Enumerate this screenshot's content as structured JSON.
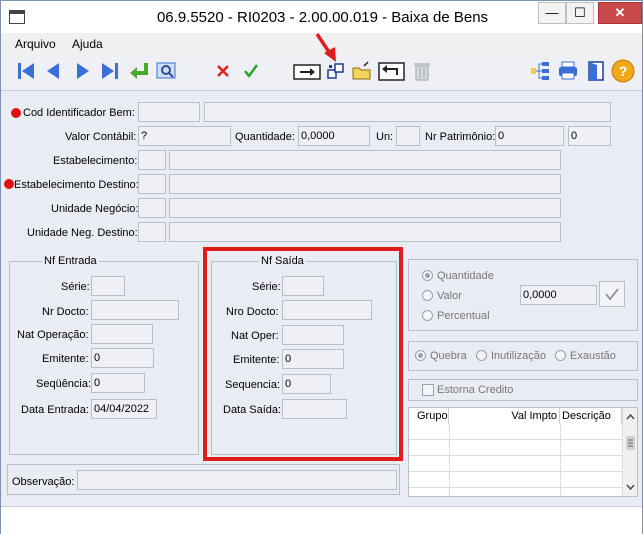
{
  "window": {
    "title": "06.9.5520 - RI0203 - 2.00.00.019 - Baixa de Bens",
    "min": "—",
    "max": "☐",
    "close": "✕"
  },
  "menu": {
    "arquivo": "Arquivo",
    "ajuda": "Ajuda"
  },
  "form": {
    "cod_label": "Cod Identificador Bem:",
    "valor_label": "Valor Contábil:",
    "valor_value": "?",
    "quantidade_label": "Quantidade:",
    "quantidade_value": "0,0000",
    "un_label": "Un:",
    "nr_patrimonio_label": "Nr Patrimônio:",
    "nr_patrimonio_value": "0",
    "nr_patrimonio_value2": "0",
    "estab_label": "Estabelecimento:",
    "estab_dest_label": "Estabelecimento Destino:",
    "unid_label": "Unidade Negócio:",
    "unid_dest_label": "Unidade Neg. Destino:"
  },
  "nf_entrada": {
    "title": "Nf Entrada",
    "serie_label": "Série:",
    "nr_docto_label": "Nr Docto:",
    "nat_op_label": "Nat Operação:",
    "emitente_label": "Emitente:",
    "emitente_value": "0",
    "sequencia_label": "Seqüência:",
    "sequencia_value": "0",
    "data_label": "Data Entrada:",
    "data_value": "04/04/2022"
  },
  "nf_saida": {
    "title": "Nf Saída",
    "serie_label": "Série:",
    "nro_docto_label": "Nro Docto:",
    "nat_oper_label": "Nat Oper:",
    "emitente_label": "Emitente:",
    "emitente_value": "0",
    "sequencia_label": "Sequencia:",
    "sequencia_value": "0",
    "data_label": "Data Saída:"
  },
  "options": {
    "quantidade": "Quantidade",
    "valor": "Valor",
    "percentual": "Percentual",
    "valor_value": "0,0000",
    "quebra": "Quebra",
    "inutilizacao": "Inutilização",
    "exaustao": "Exaustão",
    "estorna": "Estorna Credito"
  },
  "table": {
    "columns": [
      "Grupo",
      "Val Impto",
      "Descrição"
    ]
  },
  "observacao_label": "Observação:",
  "colors": {
    "required": "#e01010",
    "highlight": "#e01b1b",
    "arrow": "#e01b1b"
  }
}
